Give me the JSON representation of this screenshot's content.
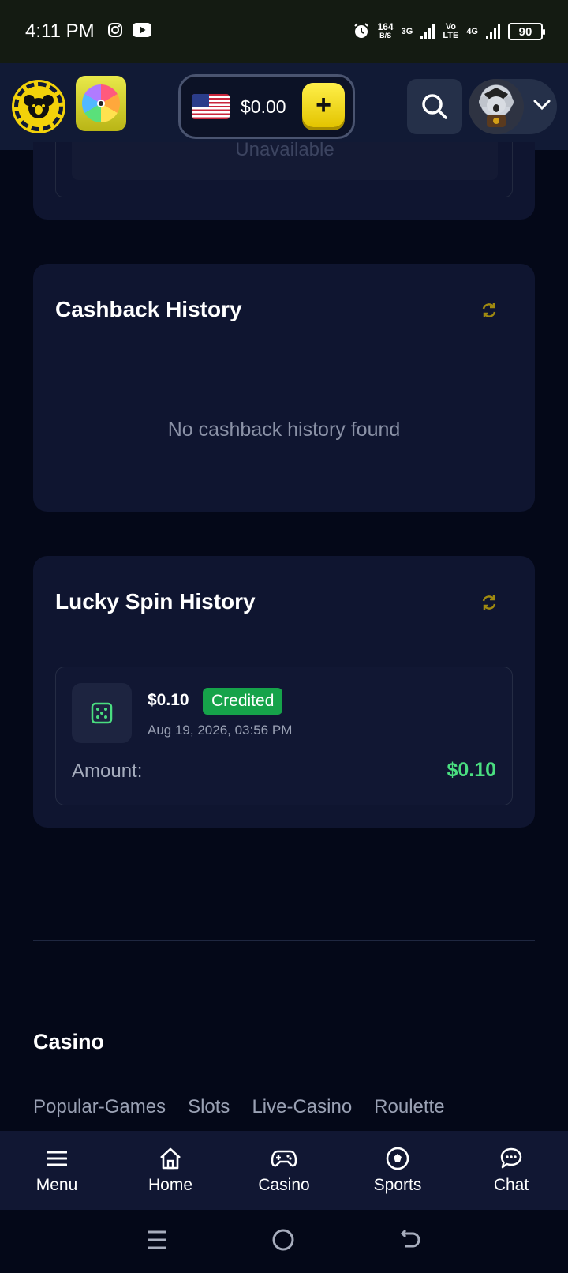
{
  "status_bar": {
    "time": "4:11 PM",
    "speed_value": "164",
    "speed_unit": "B/S",
    "network_1": "3G",
    "network_2_top": "Vo",
    "network_2_bottom": "LTE",
    "network_3": "4G",
    "battery": "90",
    "icons": [
      "instagram-icon",
      "youtube-icon",
      "alarm-icon",
      "signal-icon",
      "battery-icon"
    ]
  },
  "header": {
    "balance": "$0.00",
    "currency_flag": "us-flag",
    "deposit_symbol": "+",
    "accent_color": "#f3d20a"
  },
  "top_card": {
    "button_label": "Unavailable"
  },
  "cashback_history": {
    "title": "Cashback History",
    "empty_message": "No cashback history found"
  },
  "lucky_spin_history": {
    "title": "Lucky Spin History",
    "entries": [
      {
        "amount": "$0.10",
        "status": "Credited",
        "date": "Aug 19, 2026, 03:56 PM",
        "amount_label": "Amount:",
        "amount_value": "$0.10"
      }
    ],
    "status_color": "#16a34a",
    "value_color": "#4ade80"
  },
  "footer": {
    "section_title": "Casino",
    "links": [
      "Popular-Games",
      "Slots",
      "Live-Casino",
      "Roulette"
    ]
  },
  "bottom_nav": {
    "items": [
      {
        "label": "Menu",
        "icon": "menu-icon"
      },
      {
        "label": "Home",
        "icon": "home-icon"
      },
      {
        "label": "Casino",
        "icon": "gamepad-icon"
      },
      {
        "label": "Sports",
        "icon": "soccer-ball-icon"
      },
      {
        "label": "Chat",
        "icon": "chat-icon"
      }
    ]
  }
}
